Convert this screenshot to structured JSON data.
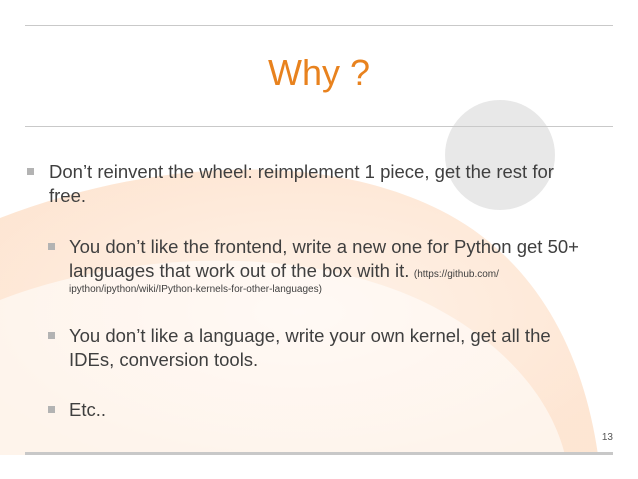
{
  "slide": {
    "title": "Why ?",
    "bullets": [
      {
        "text": "Don’t reinvent the wheel: reimplement 1 piece, get the rest for free."
      },
      {
        "text": "You don’t like the frontend, write a new one for Python get 50+ languages that work out of the box with it.",
        "url_line1": "(https://github.com/",
        "url_line2": "ipython/ipython/wiki/IPython-kernels-for-other-languages)"
      },
      {
        "text": "You don’t like a language, write your own kernel, get all the IDEs, conversion tools."
      },
      {
        "text": "Etc.."
      }
    ],
    "page_number": "13"
  },
  "colors": {
    "title": "#e8821e",
    "body_text": "#3f3f3f",
    "rule": "#c9c9c9",
    "bullet": "#b3b3b3",
    "decor_peach": "#fde3cf",
    "decor_gray": "#e6e6e6"
  }
}
